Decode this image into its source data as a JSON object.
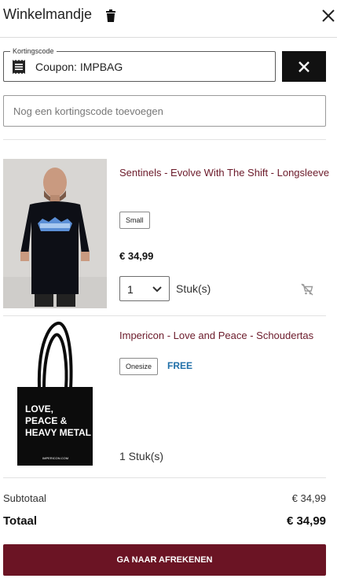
{
  "header": {
    "title": "Winkelmandje",
    "trash_icon": "trash-icon",
    "close_icon": "close-icon"
  },
  "coupon": {
    "legend": "Kortingscode",
    "value": "Coupon: IMPBAG",
    "icon": "receipt-icon",
    "remove_icon": "close-icon"
  },
  "add_code": {
    "placeholder": "Nog een kortingscode toevoegen"
  },
  "items": [
    {
      "name": "Sentinels - Evolve With The Shift - Longsleeve",
      "size": "Small",
      "price": "€ 34,99",
      "quantity": "1",
      "quantity_unit": "Stuk(s)",
      "remove_icon": "remove-from-cart-icon"
    },
    {
      "name": "Impericon - Love and Peace - Schoudertas",
      "size": "Onesize",
      "price_label": "FREE",
      "quantity_text": "1 Stuk(s)",
      "bag_print": [
        "LOVE,",
        "PEACE &",
        "HEAVY METAL"
      ],
      "bag_small_print": "IMPERICON.COM"
    }
  ],
  "summary": {
    "subtotal_label": "Subtotaal",
    "subtotal_value": "€ 34,99",
    "total_label": "Totaal",
    "total_value": "€ 34,99"
  },
  "checkout": {
    "label": "GA NAAR AFREKENEN"
  },
  "colors": {
    "brand": "#6b1424",
    "product_name": "#6b1a2a",
    "free": "#1f6fa8"
  }
}
